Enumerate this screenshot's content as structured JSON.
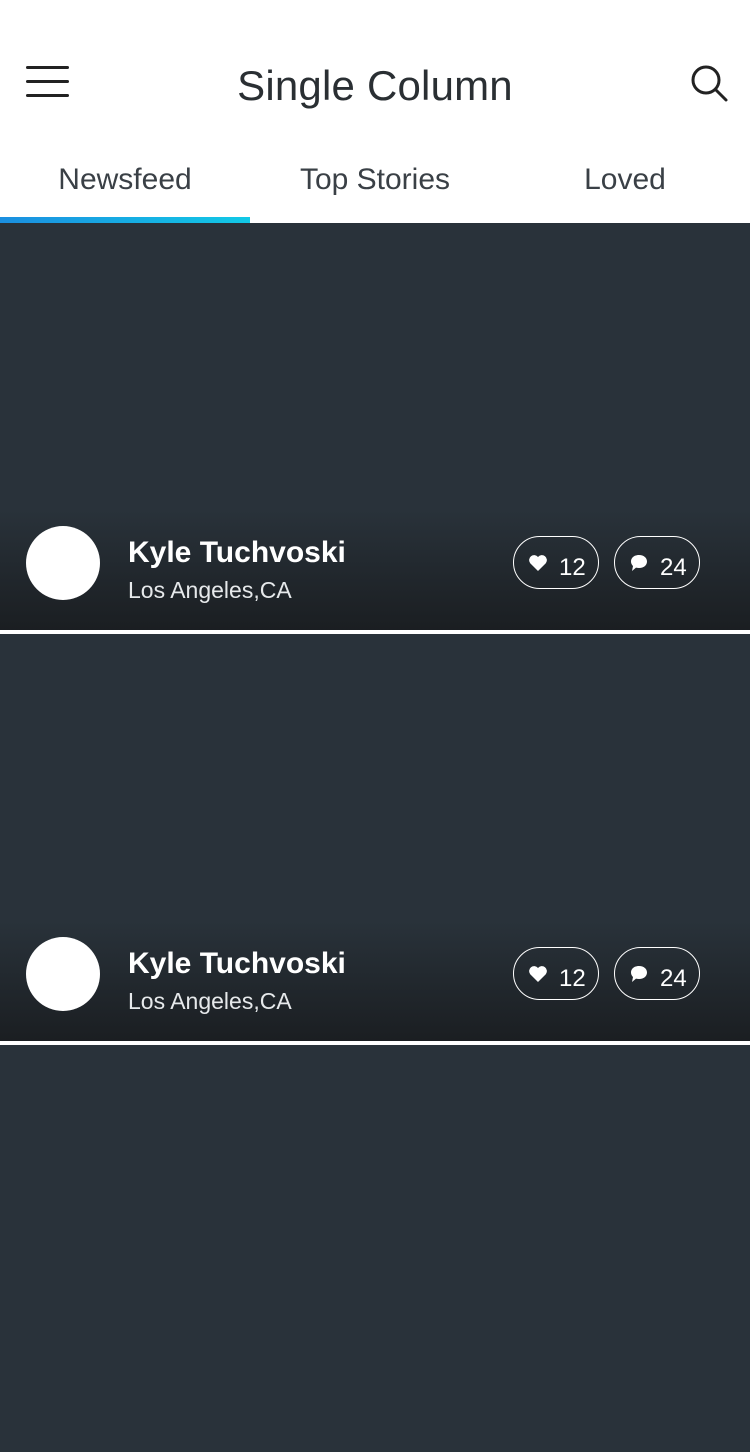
{
  "header": {
    "title": "Single Column",
    "menu_icon": "hamburger-menu-icon",
    "search_icon": "search-icon"
  },
  "tabs": [
    {
      "label": "Newsfeed",
      "active": true
    },
    {
      "label": "Top Stories",
      "active": false
    },
    {
      "label": "Loved",
      "active": false
    }
  ],
  "colors": {
    "card_background": "#29323a",
    "tab_indicator_start": "#1b8fe0",
    "tab_indicator_end": "#12c9e6",
    "title_text": "#2a2f33"
  },
  "feed": {
    "posts": [
      {
        "name": "Kyle Tuchvoski",
        "location": "Los Angeles,CA",
        "likes": "12",
        "comments": "24"
      },
      {
        "name": "Kyle Tuchvoski",
        "location": "Los Angeles,CA",
        "likes": "12",
        "comments": "24"
      }
    ]
  }
}
